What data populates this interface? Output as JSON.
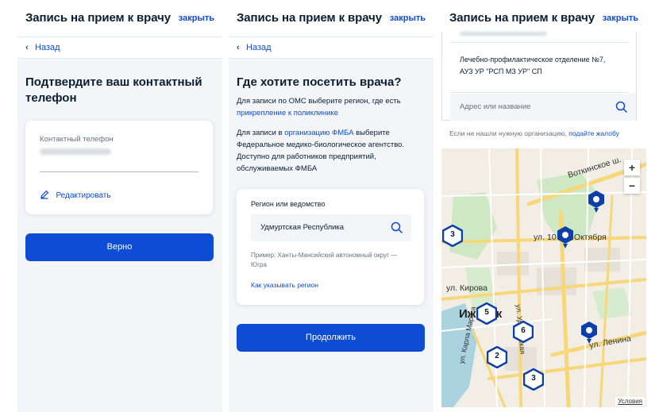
{
  "panel1": {
    "header": {
      "title": "Запись на прием к врачу",
      "close": "закрыть"
    },
    "back": "Назад",
    "heading": "Подтвердите ваш контактный телефон",
    "phone_label": "Контактный телефон",
    "edit_label": "Редактировать",
    "confirm_button": "Верно"
  },
  "panel2": {
    "header": {
      "title": "Запись на прием к врачу",
      "close": "закрыть"
    },
    "back": "Назад",
    "heading": "Где хотите посетить врача?",
    "p1_text": "Для записи по ОМС выберите регион, где есть",
    "p1_link": "прикрепление к поликлинике",
    "p2_pre": "Для записи в ",
    "p2_link": "организацию ФМБА",
    "p2_post": " выберите",
    "p2_line2": "Федеральное медико-биологическое агентство.",
    "p2_line3": "Доступно для работников предприятий,",
    "p2_line4": "обслуживаемых ФМБА",
    "region_label": "Регион или ведомство",
    "region_value": "Удмуртская Республика",
    "example_line1": "Пример: Ханты-Мансийский автономный округ —",
    "example_line2": "Югра",
    "how_link": "Как указывать регион",
    "continue_button": "Продолжить"
  },
  "panel3": {
    "header": {
      "title": "Запись на прием к врачу",
      "close": "закрыть"
    },
    "org_line1": "Лечебно-профилактическое отделение №7,",
    "org_line2": "АУЗ УР \"РСП МЗ УР\" СП",
    "search_placeholder": "Адрес или название",
    "not_found_text": "Если не нашли нужную организацию, ",
    "complaint_link": "подайте жалобу",
    "map": {
      "streets": [
        "Воткинское ш.",
        "ул. 10 лет Октября",
        "ул. Кирова",
        "Ижевск",
        "ул. Ленина",
        "ул. Карла Маркса",
        "ул. Удмуртская"
      ],
      "clusters": [
        "3",
        "5",
        "6",
        "2",
        "3"
      ],
      "zoom_in": "+",
      "zoom_out": "−",
      "terms": "Условия"
    }
  },
  "colors": {
    "accent": "#0d4cd3",
    "marker": "#0d3fa8",
    "road": "#f7d77a"
  }
}
